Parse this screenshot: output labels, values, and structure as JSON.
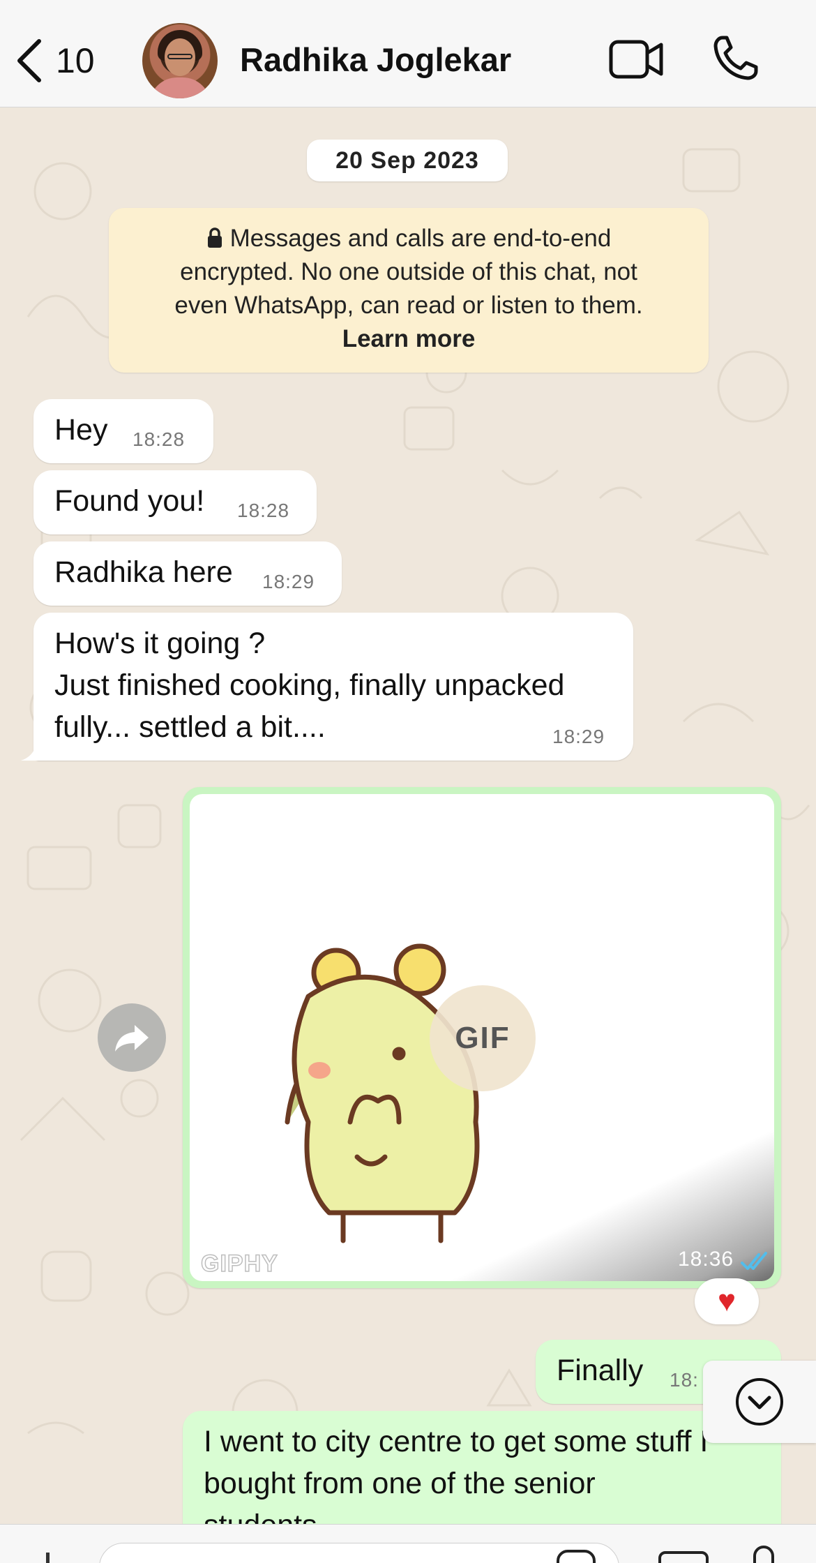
{
  "header": {
    "back_count": "10",
    "contact_name": "Radhika Joglekar"
  },
  "chat": {
    "date": "20 Sep 2023",
    "encryption_notice": {
      "line1": "Messages and calls are end-to-end",
      "line2": "encrypted. No one outside of this chat, not",
      "line3": "even WhatsApp, can read or listen to them.",
      "learn_more": "Learn more"
    },
    "messages": [
      {
        "text": "Hey",
        "time": "18:28"
      },
      {
        "text": "Found you!",
        "time": "18:28"
      },
      {
        "text": "Radhika here",
        "time": "18:29"
      },
      {
        "line1": "How's it going ?",
        "line2": "Just finished cooking, finally unpacked",
        "line3": "fully... settled a bit....",
        "time": "18:29"
      }
    ],
    "gif_message": {
      "badge": "GIF",
      "watermark": "GIPHY",
      "time": "18:36",
      "reaction": "♥"
    },
    "outgoing": [
      {
        "text": "Finally",
        "time": "18:"
      },
      {
        "line1": "I went to city centre to get some stuff I",
        "line2": "bought from one of the senior",
        "line3": "students"
      }
    ]
  },
  "colors": {
    "incoming_bubble": "#ffffff",
    "outgoing_bubble": "#d9fdd3",
    "read_ticks": "#53bdeb",
    "notice_bg": "#fcf0d0"
  }
}
